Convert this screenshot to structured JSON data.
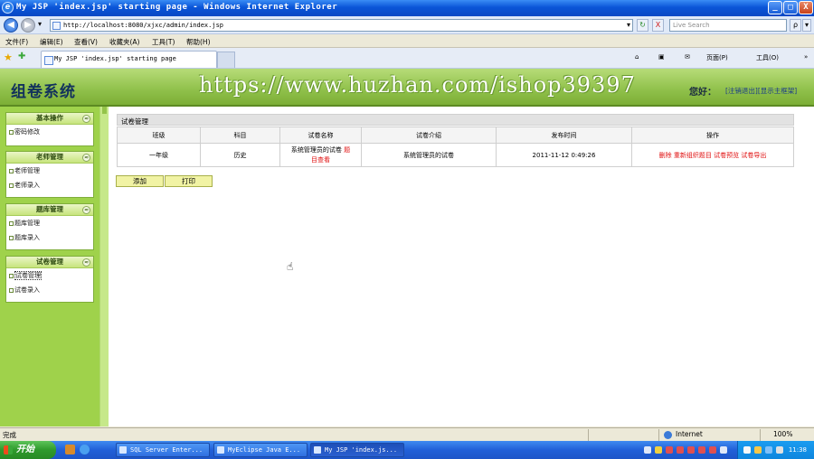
{
  "window": {
    "title": "My JSP 'index.jsp' starting page - Windows Internet Explorer",
    "min": "_",
    "max": "□",
    "close": "X"
  },
  "browser": {
    "back": "◀",
    "forward": "▶",
    "dropdown": "▾",
    "url": "http://localhost:8080/xjxc/admin/index.jsp",
    "refresh": "↻",
    "stop": "X",
    "search_placeholder": "Live Search",
    "search_go": "ρ",
    "menu": [
      "文件(F)",
      "编辑(E)",
      "查看(V)",
      "收藏夹(A)",
      "工具(T)",
      "帮助(H)"
    ],
    "tab_label": "My JSP 'index.jsp' starting page",
    "commands": [
      "页面(P)",
      "工具(O)"
    ],
    "command_glyphs": [
      "⌂",
      "▣",
      "✉",
      "»"
    ]
  },
  "app": {
    "title": "组卷系统",
    "watermark": "https://www.huzhan.com/ishop39397",
    "greeting": "您好：",
    "links": [
      "[注销退出]",
      "[显示主框架]"
    ]
  },
  "sidebar": {
    "toggle": "≈",
    "panels": [
      {
        "title": "基本操作",
        "items": [
          "密码修改"
        ]
      },
      {
        "title": "老师管理",
        "items": [
          "老师管理",
          "老师录入"
        ]
      },
      {
        "title": "题库管理",
        "items": [
          "题库管理",
          "题库录入"
        ]
      },
      {
        "title": "试卷管理",
        "items": [
          "试卷管理",
          "试卷录入"
        ]
      }
    ]
  },
  "main": {
    "section_title": "试卷管理",
    "columns": [
      "班级",
      "科目",
      "试卷名称",
      "试卷介绍",
      "发布时间",
      "操作"
    ],
    "rows": [
      {
        "grade": "一年级",
        "subject": "历史",
        "name": "系统管理员的试卷",
        "name_links": [
          "题",
          "目查看"
        ],
        "intro": "系统管理员的试卷",
        "time": "2011-11-12 0:49:26",
        "ops": [
          "删除",
          "重新组织题目",
          "试卷预览",
          "试卷导出"
        ]
      }
    ],
    "buttons": {
      "add": "添加",
      "print": "打印"
    },
    "cursor": "☝"
  },
  "status": {
    "text": "完成",
    "zone": "Internet",
    "zoom": "100%"
  },
  "taskbar": {
    "start": "开始",
    "tasks": [
      "SQL Server Enter...",
      "MyEclipse Java E...",
      "My JSP 'index.js..."
    ],
    "clock": "11:38"
  },
  "colors": {
    "header_green": "#8fc04a",
    "sidebar_green": "#9fd24b",
    "action_red": "#e01010",
    "title_blue": "#0a55d8"
  }
}
